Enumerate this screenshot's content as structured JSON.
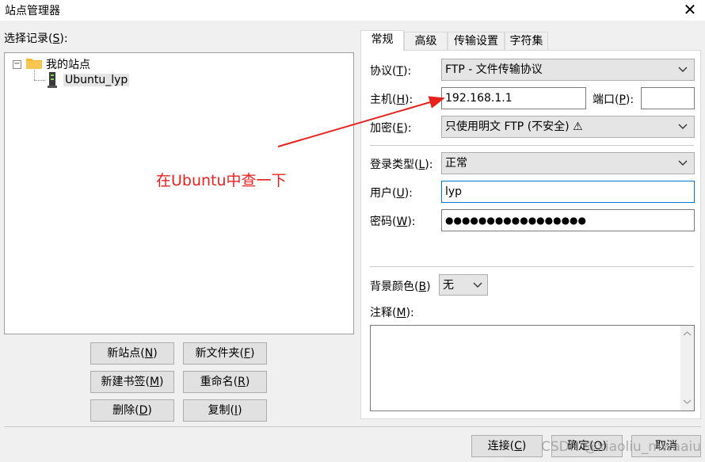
{
  "window": {
    "title": "站点管理器",
    "close_glyph": "✕"
  },
  "left": {
    "select_label_pre": "选择记录(",
    "select_label_key": "S",
    "select_label_post": "):",
    "tree": {
      "root_label": "我的站点",
      "root_toggle": "−",
      "child_label": "Ubuntu_lyp"
    },
    "buttons": {
      "new_site": {
        "pre": "新站点(",
        "key": "N",
        "post": ")"
      },
      "new_folder": {
        "pre": "新文件夹(",
        "key": "F",
        "post": ")"
      },
      "new_bookmark": {
        "pre": "新建书签(",
        "key": "M",
        "post": ")"
      },
      "rename": {
        "pre": "重命名(",
        "key": "R",
        "post": ")"
      },
      "delete": {
        "pre": "删除(",
        "key": "D",
        "post": ")"
      },
      "copy": {
        "pre": "复制(",
        "key": "I",
        "post": ")"
      }
    }
  },
  "tabs": [
    "常规",
    "高级",
    "传输设置",
    "字符集"
  ],
  "general": {
    "protocol": {
      "pre": "协议(",
      "key": "T",
      "post": "):",
      "value": "FTP - 文件传输协议"
    },
    "host": {
      "pre": "主机(",
      "key": "H",
      "post": "):",
      "value": "192.168.1.1"
    },
    "port": {
      "pre": "端口(",
      "key": "P",
      "post": "):",
      "value": ""
    },
    "encryption": {
      "pre": "加密(",
      "key": "E",
      "post": "):",
      "value": "只使用明文 FTP (不安全) ⚠"
    },
    "logon_type": {
      "pre": "登录类型(",
      "key": "L",
      "post": "):",
      "value": "正常"
    },
    "user": {
      "pre": "用户(",
      "key": "U",
      "post": "):",
      "value": "lyp"
    },
    "password": {
      "pre": "密码(",
      "key": "W",
      "post": "):",
      "value": "●●●●●●●●●●●●●●●●●"
    },
    "background_color": {
      "pre": "背景颜色(",
      "key": "B",
      "post": ")",
      "value": "无"
    },
    "comments": {
      "pre": "注释(",
      "key": "M",
      "post": "):",
      "value": ""
    }
  },
  "annotation": {
    "text": "在Ubuntu中查一下",
    "color": "#e8211d"
  },
  "footer": {
    "connect": {
      "pre": "连接(",
      "key": "C",
      "post": ")"
    },
    "ok": {
      "pre": "确定(",
      "key": "O",
      "post": ")"
    },
    "cancel": "取消",
    "watermark": "CSDN @xiaoliu_mwaaiu"
  },
  "icons": {
    "folder": "folder-icon",
    "server": "server-icon",
    "chevron": "chevron-down-icon",
    "warning": "warning-icon",
    "scroll_up": "scroll-up-icon",
    "scroll_down": "scroll-down-icon"
  }
}
